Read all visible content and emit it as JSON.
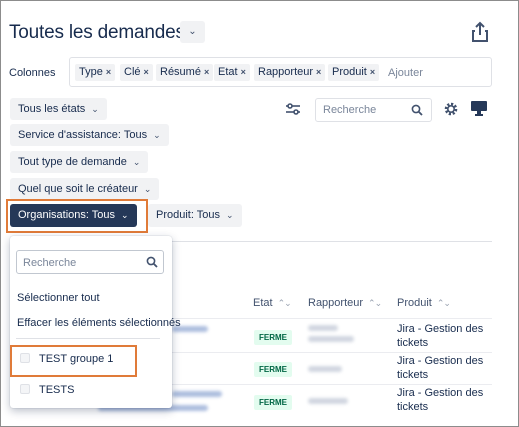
{
  "header": {
    "title": "Toutes les demandes",
    "title_dropdown_icon": "chevron-down-icon",
    "share_icon": "share-icon"
  },
  "columns": {
    "label": "Colonnes",
    "chips": [
      {
        "label": "Type"
      },
      {
        "label": "Clé"
      },
      {
        "label": "Résumé"
      },
      {
        "label": "Etat"
      },
      {
        "label": "Rapporteur"
      },
      {
        "label": "Produit"
      }
    ],
    "remove_glyph": "×",
    "placeholder": "Ajouter"
  },
  "filters": {
    "states": "Tous les états",
    "service": "Service d'assistance: Tous",
    "request_type": "Tout type de demande",
    "creator": "Quel que soit le créateur",
    "organisations": "Organisations: Tous",
    "product": "Produit: Tous"
  },
  "toolbar": {
    "search_placeholder": "Recherche",
    "icons": [
      "adjust-icon",
      "search-icon",
      "gear-icon",
      "monitor-icon"
    ]
  },
  "dropdown": {
    "search_placeholder": "Recherche",
    "select_all": "Sélectionner tout",
    "clear_selection": "Effacer les éléments sélectionnés",
    "options": [
      {
        "label": "TEST groupe 1",
        "checked": false
      },
      {
        "label": "TESTS",
        "checked": false
      }
    ]
  },
  "table": {
    "headers": [
      "Etat",
      "Rapporteur",
      "Produit"
    ],
    "sort_glyph": "⌃⌄",
    "rows": [
      {
        "status": "FERME",
        "product": "Jira - Gestion des tickets"
      },
      {
        "status": "FERME",
        "product": "Jira - Gestion des tickets"
      },
      {
        "status": "FERME",
        "product": "Jira - Gestion des tickets"
      }
    ]
  },
  "colors": {
    "primary_text": "#172b4d",
    "dark_button": "#253858",
    "highlight_outline": "#e07b39",
    "status_bg": "#e3fcef",
    "status_text": "#006644"
  }
}
